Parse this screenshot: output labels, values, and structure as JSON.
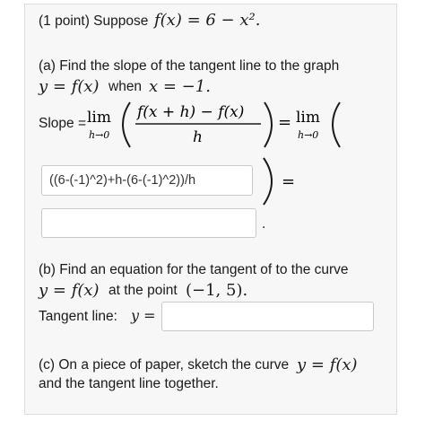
{
  "header": {
    "points": "(1 point) Suppose",
    "func": "f(x) = 6 − x².",
    "func_lhs": "f(x)",
    "func_rhs": "= 6 − x²."
  },
  "part_a": {
    "intro": "(a) Find the slope of the tangent line to the graph",
    "cond_eq": "y = f(x)",
    "cond_when": "when",
    "cond_x": "x = −1.",
    "slope_label": "Slope =",
    "lim": "lim",
    "lim_sub": "h→0",
    "numerator": "f(x + h) − f(x)",
    "denominator": "h",
    "equals": "=",
    "answer1_value": "((6-(-1)^2)+h-(6-(-1)^2))/h",
    "answer2_value": "",
    "period": "."
  },
  "part_b": {
    "intro": "(b) Find an equation for the tangent of to the curve",
    "eq": "y = f(x)",
    "at_point": "at the point",
    "point": "(−1, 5).",
    "tangent_label": "Tangent line:",
    "y_eq": "y =",
    "tangent_value": ""
  },
  "part_c": {
    "line1": "(c) On a piece of paper, sketch the curve",
    "line1_eq": "y = f(x)",
    "line2": "and the tangent line together."
  }
}
